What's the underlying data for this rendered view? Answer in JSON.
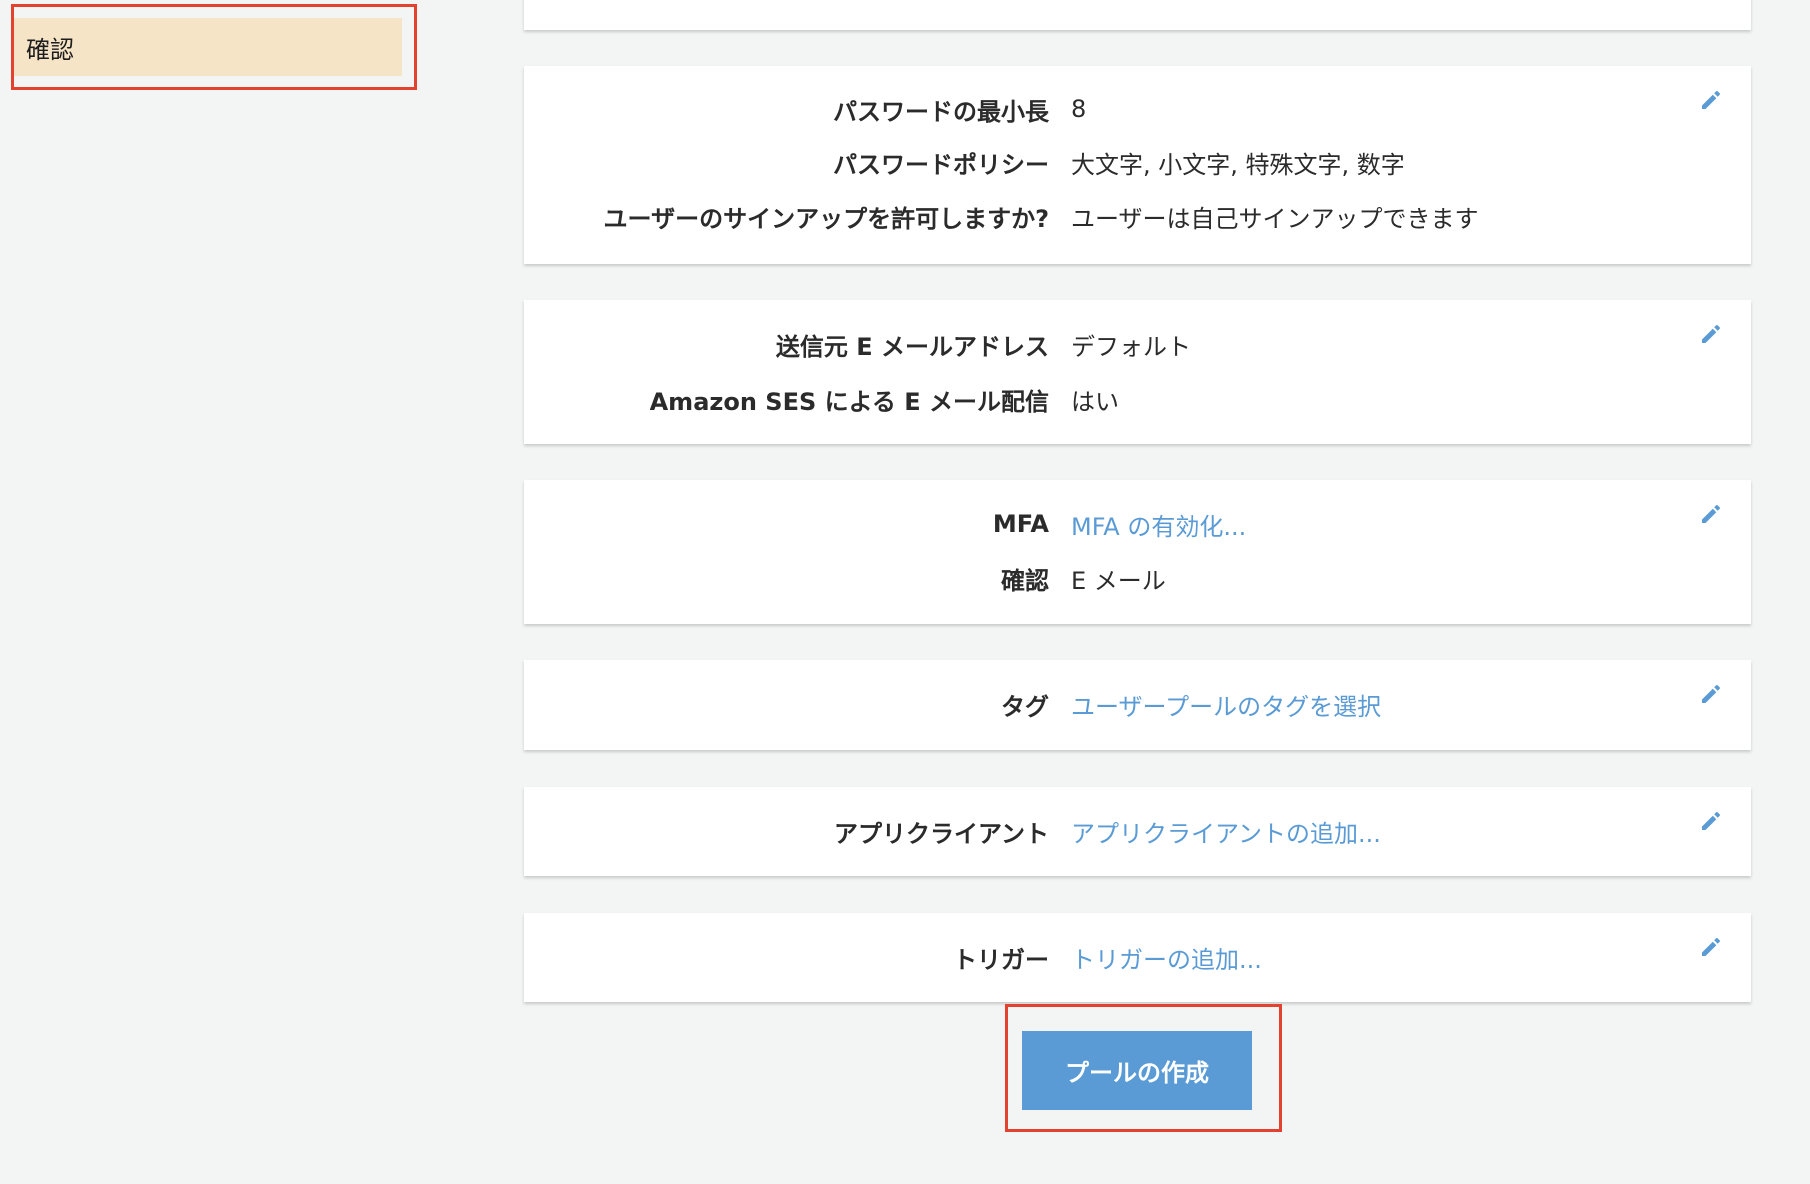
{
  "sidebar": {
    "selected_item": "確認"
  },
  "cards": {
    "password": {
      "min_length_label": "パスワードの最小長",
      "min_length_value": "8",
      "policy_label": "パスワードポリシー",
      "policy_value": "大文字, 小文字, 特殊文字, 数字",
      "signup_label": "ユーザーのサインアップを許可しますか?",
      "signup_value": "ユーザーは自己サインアップできます"
    },
    "email": {
      "from_label": "送信元 E メールアドレス",
      "from_value": "デフォルト",
      "ses_label": "Amazon SES による E メール配信",
      "ses_value": "はい"
    },
    "mfa": {
      "mfa_label": "MFA",
      "mfa_value": "MFA の有効化...",
      "verify_label": "確認",
      "verify_value": "E メール"
    },
    "tags": {
      "label": "タグ",
      "value": "ユーザープールのタグを選択"
    },
    "app_client": {
      "label": "アプリクライアント",
      "value": "アプリクライアントの追加..."
    },
    "triggers": {
      "label": "トリガー",
      "value": "トリガーの追加..."
    }
  },
  "actions": {
    "create_pool_label": "プールの作成"
  },
  "colors": {
    "accent": "#5a9bd5",
    "link": "#5b9bd5",
    "highlight_border": "#e3432e",
    "sidebar_selected_bg": "#f5e4c6",
    "page_bg": "#f3f5f4"
  },
  "icons": {
    "edit": "pencil-icon"
  }
}
